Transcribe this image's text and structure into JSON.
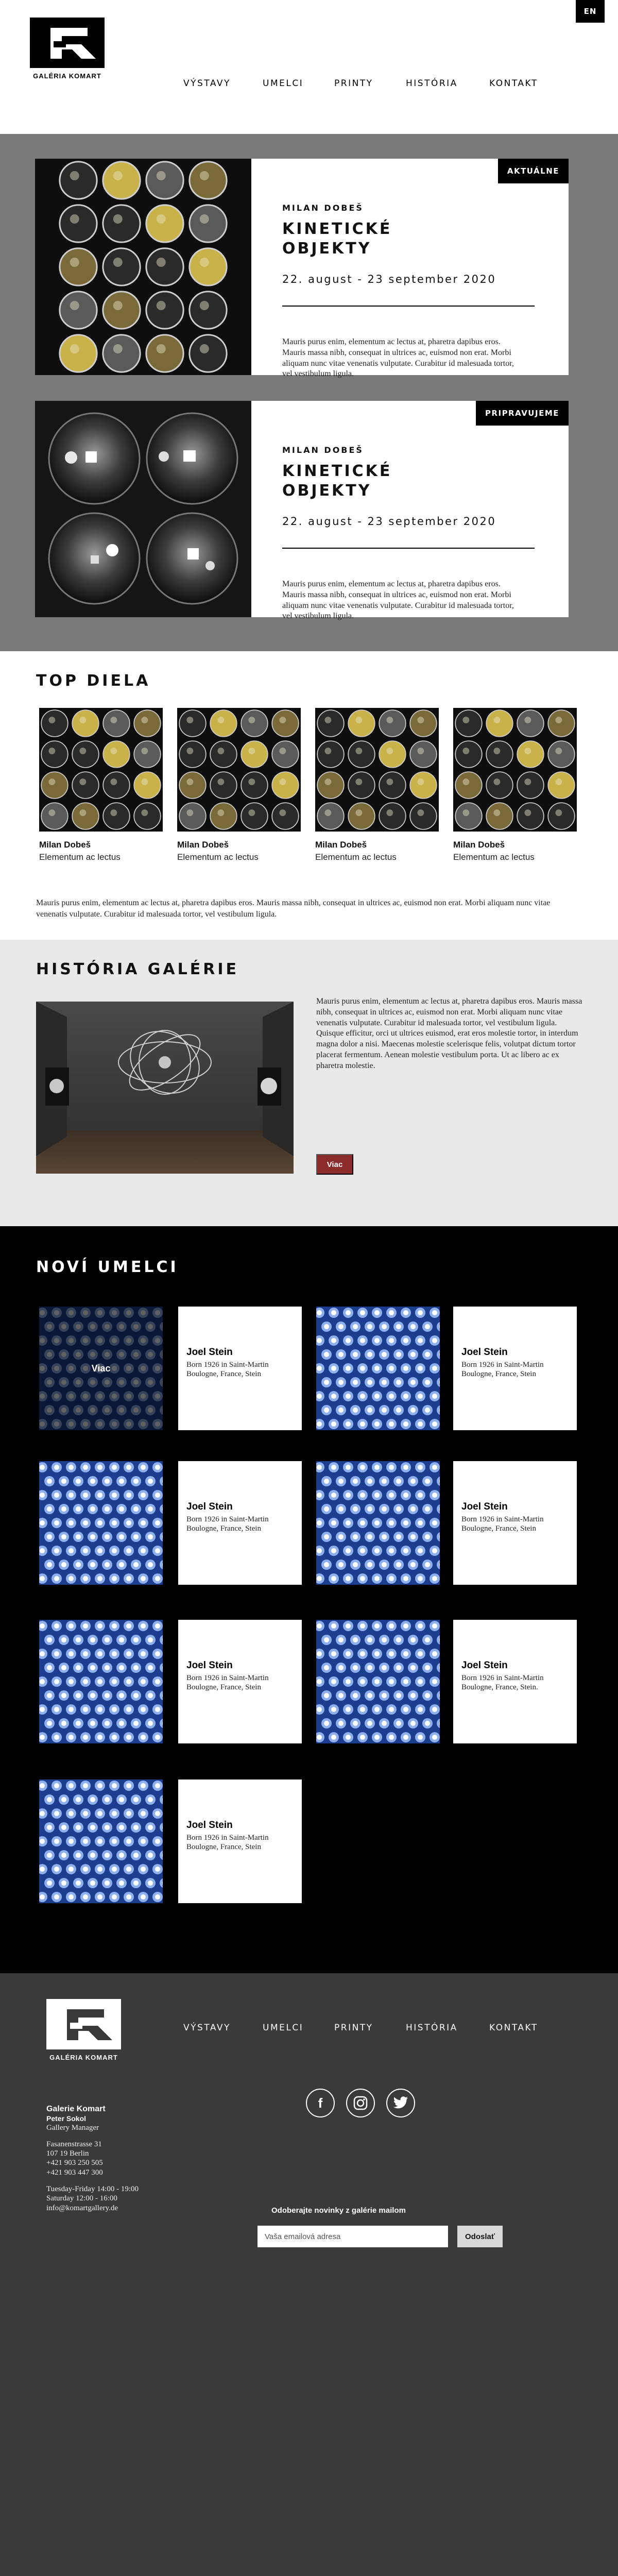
{
  "header": {
    "lang": "EN",
    "logo_caption": "GALÉRIA KOMART",
    "nav": [
      "VÝSTAVY",
      "UMELCI",
      "PRINTY",
      "HISTÓRIA",
      "KONTAKT"
    ]
  },
  "exhibitions": [
    {
      "badge": "AKTUÁLNE",
      "artist": "MILAN DOBEŠ",
      "title": "KINETICKÉ OBJEKTY",
      "date": "22. august - 23 september 2020",
      "description": "Mauris purus enim, elementum ac lectus at, pharetra dapibus eros. Mauris massa nibh, consequat in ultrices ac, euismod non erat. Morbi aliquam nunc vitae venenatis vulputate. Curabitur id malesuada tortor, vel vestibulum ligula."
    },
    {
      "badge": "PRIPRAVUJEME",
      "artist": "MILAN DOBEŠ",
      "title": "KINETICKÉ OBJEKTY",
      "date": "22. august - 23 september 2020",
      "description": "Mauris purus enim, elementum ac lectus at, pharetra dapibus eros. Mauris massa nibh, consequat in ultrices ac, euismod non erat. Morbi aliquam nunc vitae venenatis vulputate. Curabitur id malesuada tortor, vel vestibulum ligula."
    }
  ],
  "top_works": {
    "title": "TOP DIELA",
    "items": [
      {
        "artist": "Milan Dobeš",
        "name": "Elementum ac lectus"
      },
      {
        "artist": "Milan Dobeš",
        "name": "Elementum ac lectus"
      },
      {
        "artist": "Milan Dobeš",
        "name": "Elementum ac lectus"
      },
      {
        "artist": "Milan Dobeš",
        "name": "Elementum ac lectus"
      }
    ],
    "text": "Mauris purus enim, elementum ac lectus at, pharetra dapibus eros. Mauris massa nibh, consequat in ultrices ac, euismod non erat. Morbi aliquam nunc vitae venenatis vulputate. Curabitur id malesuada tortor, vel vestibulum ligula."
  },
  "history": {
    "title": "HISTÓRIA GALÉRIE",
    "text": "Mauris purus enim, elementum ac lectus at, pharetra dapibus eros. Mauris massa nibh, consequat in ultrices ac, euismod non erat. Morbi aliquam nunc vitae venenatis vulputate. Curabitur id malesuada tortor, vel vestibulum ligula. Quisque efficitur, orci ut ultrices euismod, erat eros molestie tortor, in interdum magna dolor a nisi. Maecenas molestie scelerisque felis, volutpat dictum tortor placerat fermentum. Aenean molestie vestibulum porta. Ut ac libero ac ex pharetra molestie.",
    "button": "Viac"
  },
  "artists": {
    "title": "NOVÍ UMELCI",
    "hover_label": "Viac",
    "items": [
      {
        "name": "Joel Stein",
        "bio": "Born 1926 in Saint-Martin Boulogne, France, Stein"
      },
      {
        "name": "Joel Stein",
        "bio": "Born 1926 in Saint-Martin Boulogne, France, Stein"
      },
      {
        "name": "Joel Stein",
        "bio": "Born 1926 in Saint-Martin Boulogne, France, Stein"
      },
      {
        "name": "Joel Stein",
        "bio": "Born 1926 in Saint-Martin Boulogne, France, Stein"
      },
      {
        "name": "Joel Stein",
        "bio": "Born 1926 in Saint-Martin Boulogne, France, Stein"
      },
      {
        "name": "Joel Stein",
        "bio": "Born 1926 in Saint-Martin Boulogne, France, Stein."
      },
      {
        "name": "Joel Stein",
        "bio": "Born 1926 in Saint-Martin Boulogne, France, Stein"
      }
    ]
  },
  "footer": {
    "logo_caption": "GALÉRIA KOMART",
    "nav": [
      "VÝSTAVY",
      "UMELCI",
      "PRINTY",
      "HISTÓRIA",
      "KONTAKT"
    ],
    "social": [
      {
        "icon": "facebook-icon",
        "glyph": "f"
      },
      {
        "icon": "instagram-icon",
        "glyph": "◎"
      },
      {
        "icon": "twitter-icon",
        "glyph": "🐦"
      }
    ],
    "contact": {
      "name": "Galerie Komart",
      "person": "Peter Sokol",
      "role": "Gallery Manager",
      "street": "Fasanenstrasse 31",
      "city": "107 19 Berlin",
      "phone1": "+421 903 250 505",
      "phone2": "+421 903 447 300",
      "hours1": "Tuesday-Friday 14:00 - 19:00",
      "hours2": "Saturday 12:00 - 16:00",
      "email": "info@komartgallery.de"
    },
    "newsletter": {
      "label": "Odoberajte novinky z galérie mailom",
      "placeholder": "Vaša emailová adresa",
      "button": "Odoslať"
    }
  },
  "colors": {
    "exhibitions_bg": "#7a7a7a",
    "history_bg": "#e9e9e9",
    "artists_bg": "#000000",
    "footer_bg": "#3a3a3a",
    "accent_button": "#8b2b2b",
    "artwork_blue": "#1d3e8e"
  }
}
